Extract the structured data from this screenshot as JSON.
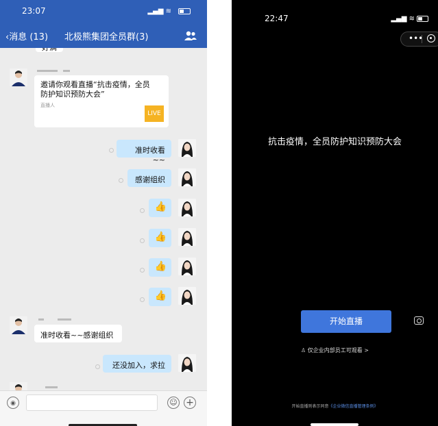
{
  "left_screen": {
    "status_time": "23:07",
    "nav": {
      "back_label": "消息 (13)",
      "title": "北极熊集团全员群(3)"
    },
    "partial_top_text": "好满",
    "invite_card": {
      "text": "邀请你观看直播“抗击疫情，全员防护知识预防大会”",
      "anchor_label": "直播人",
      "live_badge": "LIVE"
    },
    "messages_right": [
      {
        "text": "准时收看~~"
      },
      {
        "text": "感谢组织"
      },
      {
        "text": "👍"
      },
      {
        "text": "👍"
      },
      {
        "text": "👍"
      },
      {
        "text": "👍"
      }
    ],
    "message_left": {
      "text": "准时收看~~感谢组织"
    },
    "message_right_last": {
      "text": "还没加入，求拉"
    },
    "colors": {
      "header": "#2f5fb7",
      "bubble_sent": "#c9e7fd",
      "live_badge": "#f5b323"
    }
  },
  "right_screen": {
    "status_time": "22:47",
    "capsule": {
      "more": "•••"
    },
    "live_title": "抗击疫情，全员防护知识预防大会",
    "start_button": "开始直播",
    "visibility": "仅企业内部员工可观看 >",
    "agreement_prefix": "开始直播则表示同意",
    "agreement_link": "《企业微信直播管理条例》",
    "colors": {
      "button": "#3f76dc",
      "link": "#5b8fe6"
    }
  }
}
